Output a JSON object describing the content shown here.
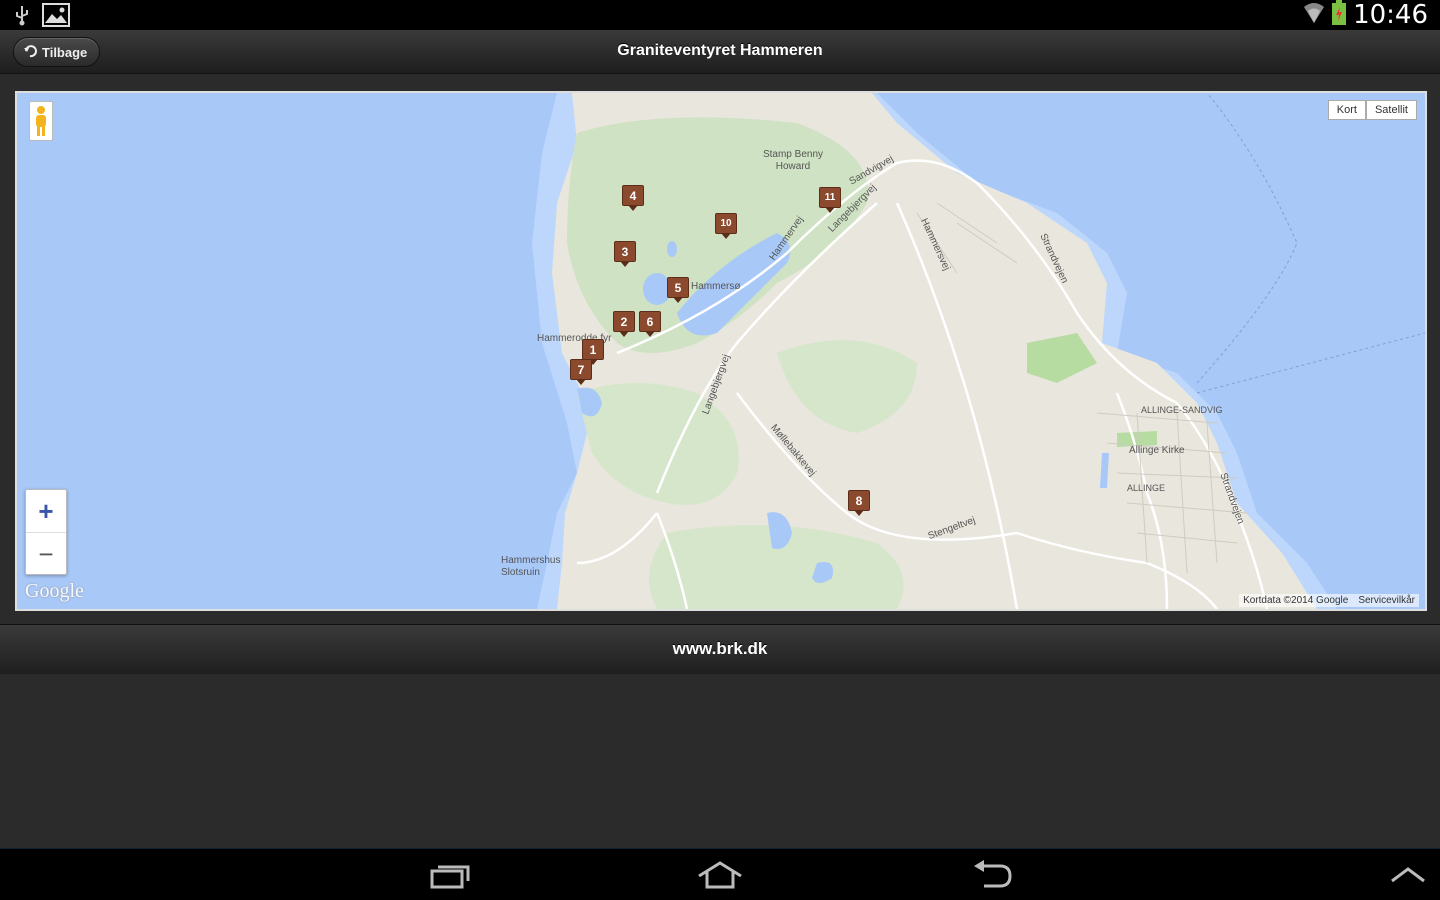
{
  "status_bar": {
    "time": "10:46",
    "icons": [
      "usb-icon",
      "image-notification-icon",
      "wifi-icon",
      "battery-icon"
    ]
  },
  "header": {
    "back_label": "Tilbage",
    "title": "Graniteventyret Hammeren"
  },
  "map": {
    "map_type_options": [
      "Kort",
      "Satellit"
    ],
    "zoom_in": "+",
    "zoom_out": "−",
    "logo": "Google",
    "attribution": {
      "data": "Kortdata ©2014 Google",
      "terms": "Servicevilkår"
    },
    "labels": [
      "Stamp Benny Howard",
      "Hammerodde fyr",
      "Hammersø",
      "Hammershus Slotsruin",
      "Allinge Kirke",
      "ALLINGE-SANDVIG",
      "ALLINGE",
      "Langebjergvej",
      "Møllebakkevej",
      "Strandvejen",
      "Sandvigvej",
      "Hammersvej",
      "Stengeltvej",
      "Langebjergvej",
      "Strandvejen",
      "Hammervej"
    ],
    "markers": [
      "4",
      "10",
      "3",
      "5",
      "2",
      "6",
      "1",
      "7",
      "11",
      "8"
    ]
  },
  "footer": {
    "link": "www.brk.dk"
  },
  "colors": {
    "water": "#a8c8f8",
    "land": "#e9e6dd",
    "green": "#cfe2c3",
    "marker": "#8b4a2e"
  }
}
